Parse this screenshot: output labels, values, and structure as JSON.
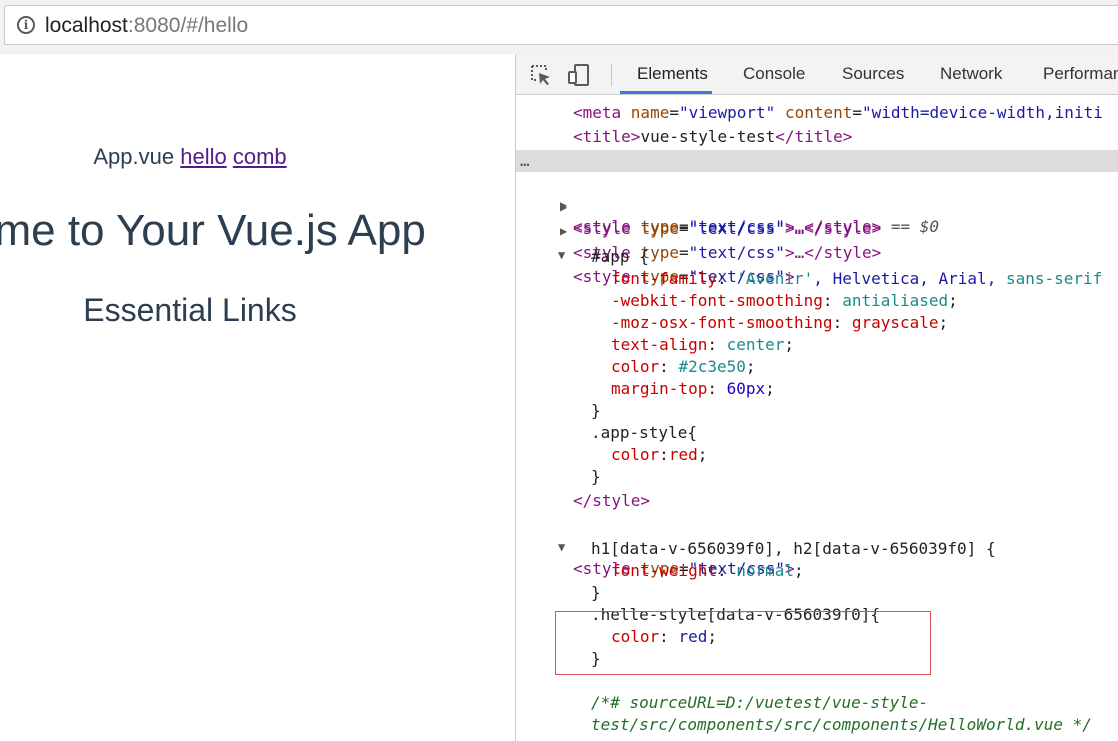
{
  "browser": {
    "url_host": "localhost",
    "url_rest": ":8080/#/hello"
  },
  "page": {
    "nav_static": "App.vue",
    "nav_link_1": "hello",
    "nav_link_2": "comb",
    "heading": "ome to Your Vue.js App",
    "subheading": "Essential Links"
  },
  "devtools": {
    "tabs": [
      "Elements",
      "Console",
      "Sources",
      "Network",
      "Performan"
    ],
    "active_tab": "Elements",
    "colors": {
      "accent": "#3879d9",
      "tag": "#881280",
      "property": "#c80000",
      "highlight_box": "#d9534f"
    },
    "lines": {
      "meta_pre": "<meta ",
      "meta_attr1": "name",
      "meta_val1": "\"viewport\"",
      "meta_attr2": "content",
      "meta_val2": "\"width=device-width,initi",
      "title_open": "<title>",
      "title_text": "vue-style-test",
      "title_close": "</title>",
      "style_open": "<style ",
      "style_attr": "type",
      "style_val": "\"text/css\"",
      "style_ellipsis": ">…</style>",
      "selected_ref": " == $0",
      "gt": ">",
      "app_selector": "#app {",
      "p_font_family": "font-family",
      "v_avenir": "'Avenir'",
      "v_rest_fonts": ", Helvetica, Arial, ",
      "v_sans": "sans-serif",
      "p_webkit": "-webkit-font-smoothing",
      "v_antialiased": "antialiased",
      "p_moz": "-moz-osx-font-smoothing",
      "v_grayscale": "grayscale",
      "p_text_align": "text-align",
      "v_center": "center",
      "p_color": "color",
      "v_hex": "#2c3e50",
      "p_margin_top": "margin-top",
      "v_60px": "60px",
      "close_brace": "}",
      "app_style_selector": ".app-style{",
      "v_red": "red",
      "style_close": "</style>",
      "h_selector": "h1[data-v-656039f0], h2[data-v-656039f0] {",
      "p_font_weight": "font-weight",
      "v_normal": "normal",
      "helle_selector": ".helle-style[data-v-656039f0]{",
      "comment_1": "/*# sourceURL=D:/vuetest/vue-style-",
      "comment_2": "test/src/components/src/components/HelloWorld.vue */",
      "colon": ":",
      "colon_sp": ": ",
      "semi": ";"
    }
  }
}
